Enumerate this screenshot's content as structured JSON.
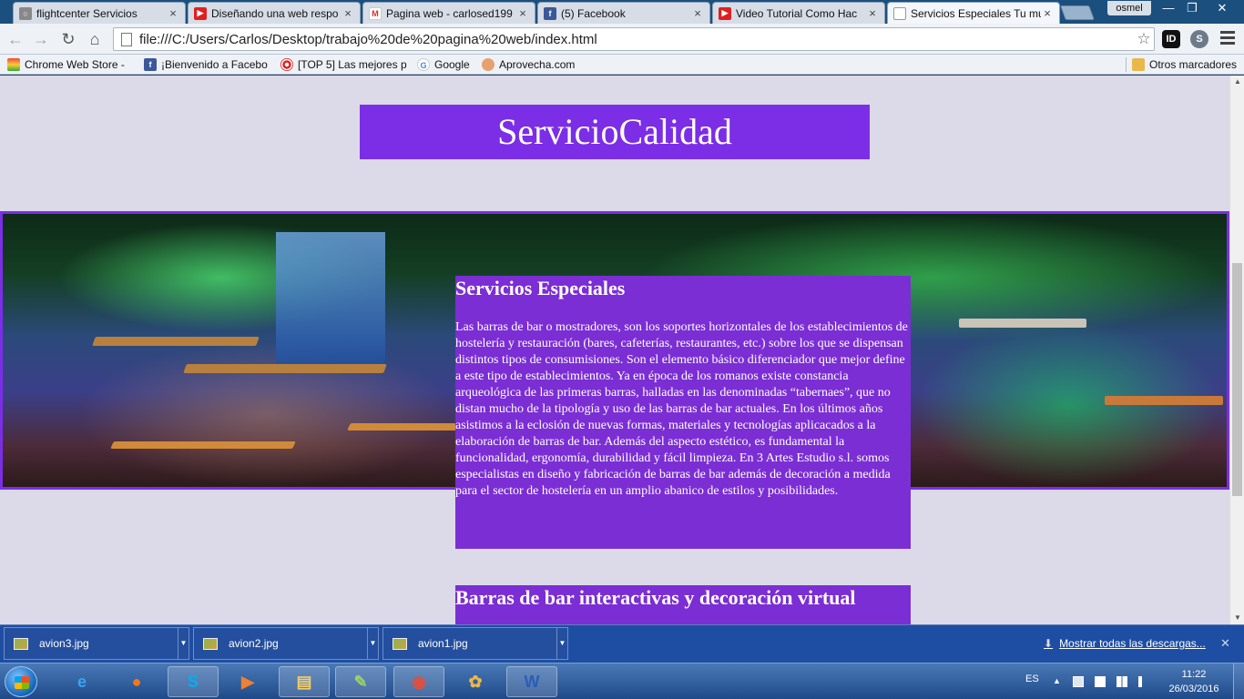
{
  "browser": {
    "tabs": [
      {
        "title": "flightcenter Servicios",
        "icon": "page-icon"
      },
      {
        "title": "Diseñando una web respo",
        "icon": "youtube-icon"
      },
      {
        "title": "Pagina web - carlosed199",
        "icon": "gmail-icon"
      },
      {
        "title": "(5) Facebook",
        "icon": "facebook-icon"
      },
      {
        "title": "Video Tutorial Como Hac",
        "icon": "youtube-icon"
      },
      {
        "title": "Servicios Especiales Tu mu",
        "icon": "page-icon",
        "active": true
      }
    ],
    "close_glyph": "×",
    "user": "osmel",
    "window_controls": {
      "minimize": "—",
      "maximize": "❐",
      "close": "✕"
    },
    "nav": {
      "back": "←",
      "forward": "→",
      "reload": "↻",
      "home": "⌂"
    },
    "url": "file:///C:/Users/Carlos/Desktop/trabajo%20de%20pagina%20web/index.html",
    "bookmark_star": "☆",
    "extensions": [
      {
        "label": "ID",
        "color": "#111111"
      },
      {
        "label": "S",
        "color": "#6c7a89"
      }
    ],
    "bookmarks": [
      {
        "label": "Chrome Web Store - ",
        "icon": "chrome-store-icon"
      },
      {
        "label": "¡Bienvenido a Facebo",
        "icon": "facebook-icon"
      },
      {
        "label": "[TOP 5] Las mejores p",
        "icon": "target-icon"
      },
      {
        "label": "Google",
        "icon": "google-icon"
      },
      {
        "label": "Aprovecha.com",
        "icon": "aprovecha-icon"
      }
    ],
    "other_bookmarks": "Otros marcadores"
  },
  "page": {
    "heading": "ServicioCalidad",
    "articles": [
      {
        "title": "Servicios Especiales",
        "body": "Las barras de bar o mostradores, son los soportes horizontales de los establecimientos de hostelería y restauración (bares, cafeterías, restaurantes, etc.) sobre los que se dispensan distintos tipos de consumisiones. Son el elemento básico diferenciador que mejor define a este tipo de establecimientos. Ya en época de los romanos existe constancia arqueológica de las primeras barras, halladas en las denominadas “tabernaes”, que no distan mucho de la tipología y uso de las barras de bar actuales. En los últimos años asistimos a la eclosión de nuevas formas, materiales y tecnologías aplicacados a la elaboración de barras de bar. Además del aspecto estético, es fundamental la funcionalidad, ergonomía, durabilidad y fácil limpieza. En 3 Artes Estudio s.l. somos especialistas en diseño y fabricación de barras de bar además de decoración a medida para el sector de hostelería en un amplio abanico de estilos y posibilidades."
      },
      {
        "title": "Barras de bar interactivas y decoración virtual"
      }
    ],
    "colors": {
      "accent": "#7b2ee6",
      "background": "#dcdae8"
    }
  },
  "downloads": {
    "items": [
      {
        "name": "avion3.jpg"
      },
      {
        "name": "avion2.jpg"
      },
      {
        "name": "avion1.jpg"
      }
    ],
    "show_all": "Mostrar todas las descargas...",
    "close_glyph": "✕"
  },
  "taskbar": {
    "apps": [
      {
        "name": "internet-explorer",
        "glyph": "e",
        "color": "#3aa3f0"
      },
      {
        "name": "firefox",
        "glyph": "●",
        "color": "#f07a1a"
      },
      {
        "name": "skype",
        "glyph": "S",
        "color": "#00aff0",
        "open": true
      },
      {
        "name": "media-player",
        "glyph": "▶",
        "color": "#f08030"
      },
      {
        "name": "file-explorer",
        "glyph": "▤",
        "color": "#f2cf6a",
        "open": true
      },
      {
        "name": "notepad-chart",
        "glyph": "✎",
        "color": "#9bd06a",
        "open": true
      },
      {
        "name": "chrome",
        "glyph": "◉",
        "color": "#e44d3a",
        "open": true
      },
      {
        "name": "paint",
        "glyph": "✿",
        "color": "#e9b64d"
      },
      {
        "name": "word",
        "glyph": "W",
        "color": "#2b5db8",
        "open": true
      }
    ],
    "language": "ES",
    "time": "11:22",
    "date": "26/03/2016"
  }
}
